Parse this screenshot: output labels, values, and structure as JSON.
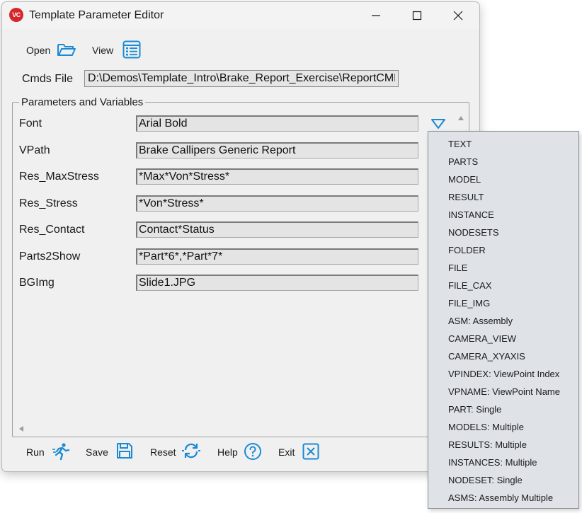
{
  "window": {
    "title": "Template Parameter Editor",
    "logo_text": "VC"
  },
  "toolbar": {
    "open_label": "Open",
    "view_label": "View"
  },
  "cmds": {
    "label": "Cmds File",
    "value": "D:\\Demos\\Template_Intro\\Brake_Report_Exercise\\ReportCMDs.txt"
  },
  "params_group": {
    "title": "Parameters and Variables",
    "rows": [
      {
        "label": "Font",
        "value": "Arial Bold"
      },
      {
        "label": "VPath",
        "value": "Brake Callipers Generic Report"
      },
      {
        "label": "Res_MaxStress",
        "value": "*Max*Von*Stress*"
      },
      {
        "label": "Res_Stress",
        "value": "*Von*Stress*"
      },
      {
        "label": "Res_Contact",
        "value": "Contact*Status"
      },
      {
        "label": "Parts2Show",
        "value": "*Part*6*,*Part*7*"
      },
      {
        "label": "BGImg",
        "value": "Slide1.JPG"
      }
    ]
  },
  "dropdown": {
    "items": [
      "TEXT",
      "PARTS",
      "MODEL",
      "RESULT",
      "INSTANCE",
      "NODESETS",
      "FOLDER",
      "FILE",
      "FILE_CAX",
      "FILE_IMG",
      "ASM: Assembly",
      "CAMERA_VIEW",
      "CAMERA_XYAXIS",
      "VPINDEX: ViewPoint Index",
      "VPNAME: ViewPoint Name",
      "PART: Single",
      "MODELS: Multiple",
      "RESULTS: Multiple",
      "INSTANCES: Multiple",
      "NODESET: Single",
      "ASMS: Assembly Multiple"
    ]
  },
  "bottom": {
    "run_label": "Run",
    "save_label": "Save",
    "reset_label": "Reset",
    "help_label": "Help",
    "exit_label": "Exit"
  },
  "colors": {
    "accent": "#1a8ad4",
    "logo_red": "#d3272b",
    "dropdown_bg": "#dfe3e8"
  }
}
